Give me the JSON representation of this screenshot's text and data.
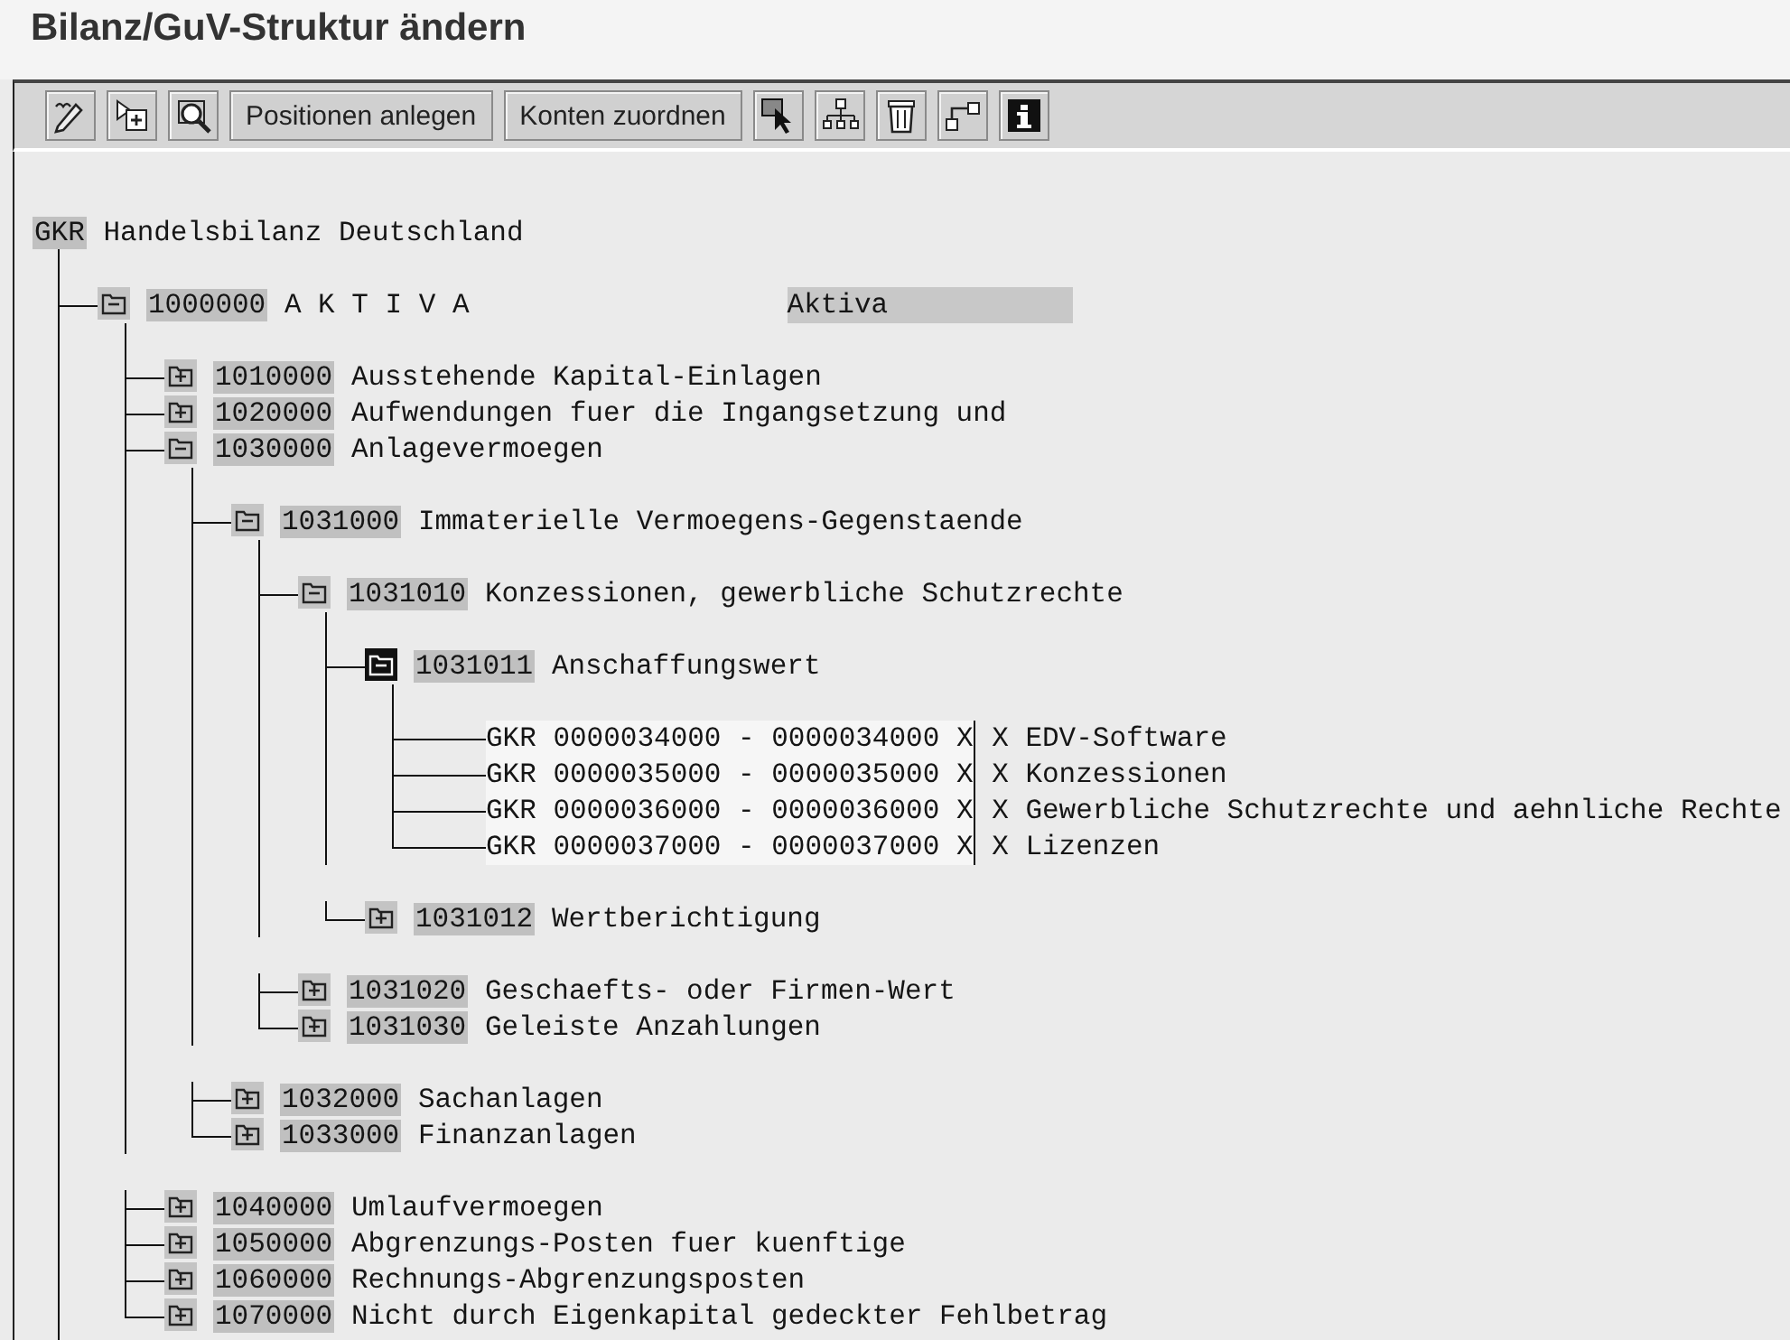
{
  "window": {
    "title": "Bilanz/GuV-Struktur ändern"
  },
  "toolbar": [
    {
      "kind": "icon"
    },
    {
      "kind": "icon"
    },
    {
      "kind": "icon"
    },
    {
      "kind": "text",
      "label": "Positionen anlegen"
    },
    {
      "kind": "text",
      "label": "Konten zuordnen"
    },
    {
      "kind": "icon"
    },
    {
      "kind": "icon"
    },
    {
      "kind": "icon"
    },
    {
      "kind": "icon"
    },
    {
      "kind": "icon"
    }
  ],
  "tree": {
    "kind": "root",
    "code": "GKR",
    "text": "Handelsbilanz Deutschland",
    "more_below": true,
    "children": [
      {
        "kind": "node",
        "code": "1000000",
        "text": "A K T I V A",
        "extra": "Aktiva",
        "expanded": true,
        "selected": false,
        "children": [
          {
            "kind": "node",
            "code": "1010000",
            "text": "Ausstehende Kapital-Einlagen",
            "expanded": false,
            "selected": false
          },
          {
            "kind": "node",
            "code": "1020000",
            "text": "Aufwendungen fuer die Ingangsetzung und",
            "expanded": false,
            "selected": false
          },
          {
            "kind": "node",
            "code": "1030000",
            "text": "Anlagevermoegen",
            "expanded": true,
            "selected": false,
            "children": [
              {
                "kind": "node",
                "code": "1031000",
                "text": "Immaterielle Vermoegens-Gegenstaende",
                "expanded": true,
                "selected": false,
                "children": [
                  {
                    "kind": "node",
                    "code": "1031010",
                    "text": "Konzessionen, gewerbliche Schutzrechte",
                    "expanded": true,
                    "selected": false,
                    "children": [
                      {
                        "kind": "node",
                        "code": "1031011",
                        "text": "Anschaffungswert",
                        "expanded": true,
                        "selected": true,
                        "children": [
                          {
                            "kind": "account",
                            "chart": "GKR",
                            "from": "0000034000",
                            "dash": "-",
                            "to": "0000034000",
                            "flag_1": "X",
                            "flag_2": "X",
                            "text": "EDV-Software"
                          },
                          {
                            "kind": "account",
                            "chart": "GKR",
                            "from": "0000035000",
                            "dash": "-",
                            "to": "0000035000",
                            "flag_1": "X",
                            "flag_2": "X",
                            "text": "Konzessionen"
                          },
                          {
                            "kind": "account",
                            "chart": "GKR",
                            "from": "0000036000",
                            "dash": "-",
                            "to": "0000036000",
                            "flag_1": "X",
                            "flag_2": "X",
                            "text": "Gewerbliche Schutzrechte und aehnliche Rechte"
                          },
                          {
                            "kind": "account",
                            "chart": "GKR",
                            "from": "0000037000",
                            "dash": "-",
                            "to": "0000037000",
                            "flag_1": "X",
                            "flag_2": "X",
                            "text": "Lizenzen"
                          }
                        ]
                      },
                      {
                        "kind": "node",
                        "code": "1031012",
                        "text": "Wertberichtigung",
                        "expanded": false,
                        "selected": false
                      }
                    ]
                  },
                  {
                    "kind": "node",
                    "code": "1031020",
                    "text": "Geschaefts- oder Firmen-Wert",
                    "expanded": false,
                    "selected": false
                  },
                  {
                    "kind": "node",
                    "code": "1031030",
                    "text": "Geleiste Anzahlungen",
                    "expanded": false,
                    "selected": false
                  }
                ]
              },
              {
                "kind": "node",
                "code": "1032000",
                "text": "Sachanlagen",
                "expanded": false,
                "selected": false
              },
              {
                "kind": "node",
                "code": "1033000",
                "text": "Finanzanlagen",
                "expanded": false,
                "selected": false
              }
            ]
          },
          {
            "kind": "node",
            "code": "1040000",
            "text": "Umlaufvermoegen",
            "expanded": false,
            "selected": false
          },
          {
            "kind": "node",
            "code": "1050000",
            "text": "Abgrenzungs-Posten fuer kuenftige",
            "expanded": false,
            "selected": false
          },
          {
            "kind": "node",
            "code": "1060000",
            "text": "Rechnungs-Abgrenzungsposten",
            "expanded": false,
            "selected": false
          },
          {
            "kind": "node",
            "code": "1070000",
            "text": "Nicht durch Eigenkapital gedeckter Fehlbetrag",
            "expanded": false,
            "selected": false
          }
        ]
      }
    ]
  }
}
